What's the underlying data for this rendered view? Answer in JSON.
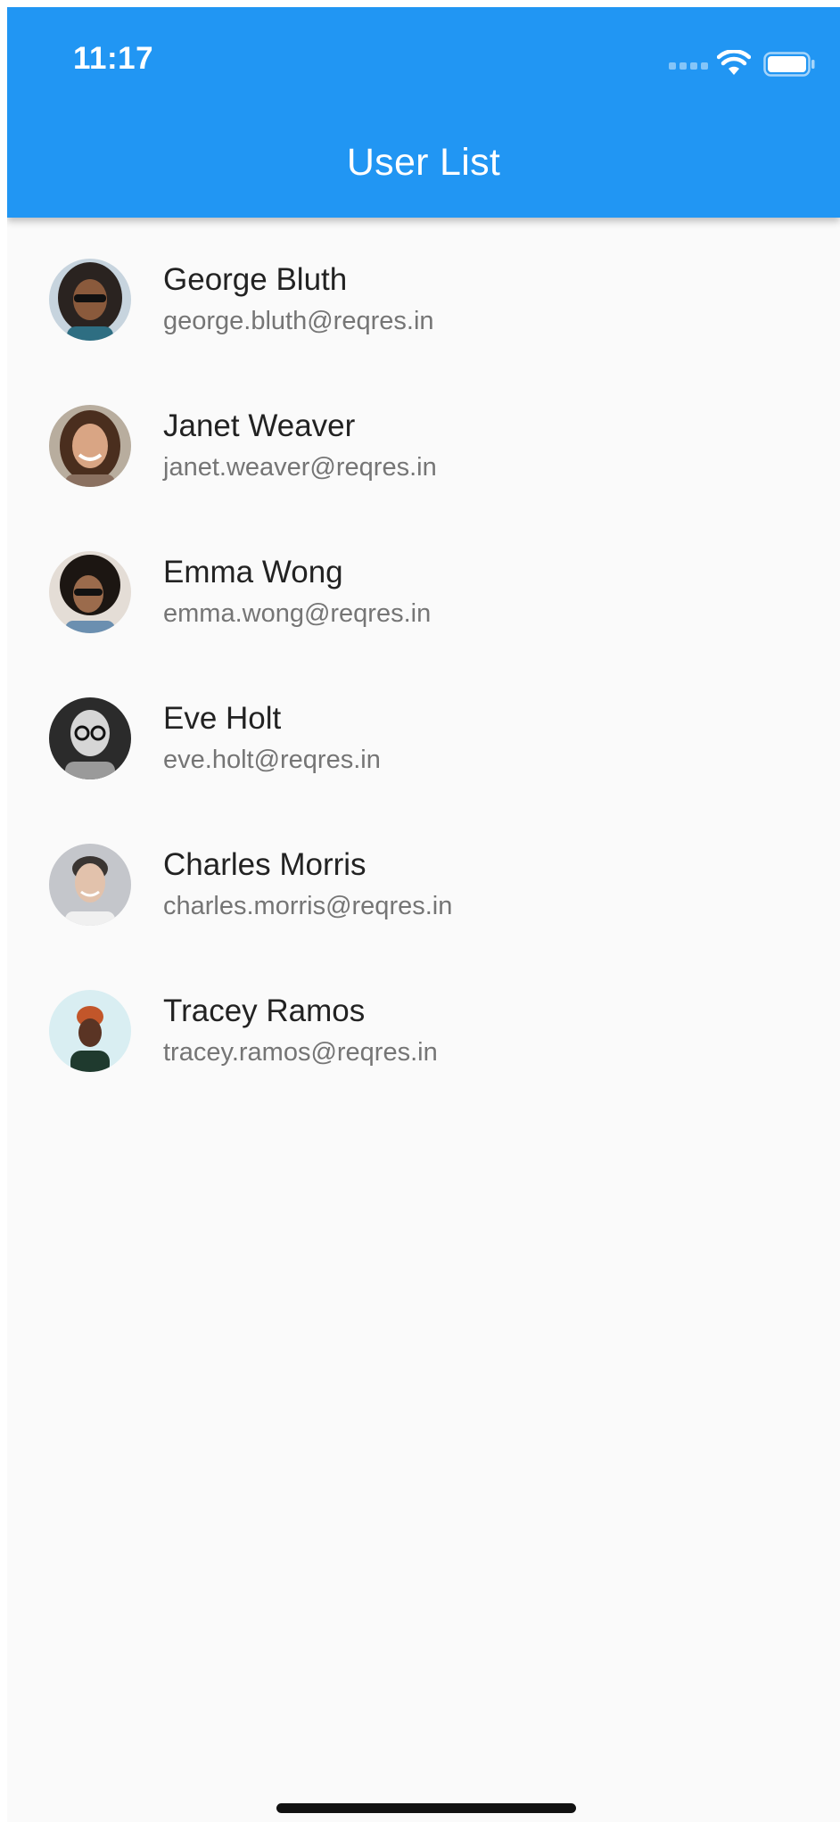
{
  "status_bar": {
    "time": "11:17"
  },
  "app_bar": {
    "title": "User List",
    "color": "#2196f3"
  },
  "icons": {
    "wifi": "wifi-icon",
    "battery": "battery-icon",
    "signal": "signal-icon"
  },
  "users": [
    {
      "name": "George Bluth",
      "email": "george.bluth@reqres.in"
    },
    {
      "name": "Janet Weaver",
      "email": "janet.weaver@reqres.in"
    },
    {
      "name": "Emma Wong",
      "email": "emma.wong@reqres.in"
    },
    {
      "name": "Eve Holt",
      "email": "eve.holt@reqres.in"
    },
    {
      "name": "Charles Morris",
      "email": "charles.morris@reqres.in"
    },
    {
      "name": "Tracey Ramos",
      "email": "tracey.ramos@reqres.in"
    }
  ]
}
